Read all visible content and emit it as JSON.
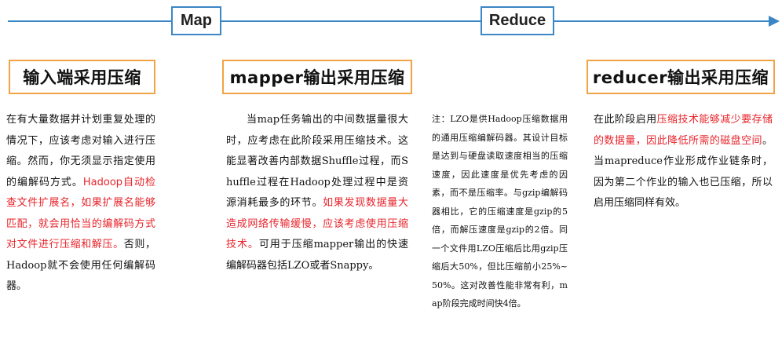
{
  "flow": {
    "map_label": "Map",
    "reduce_label": "Reduce"
  },
  "headings": {
    "input": "输入端采用压缩",
    "mapper": "mapper输出采用压缩",
    "reducer": "reducer输出采用压缩"
  },
  "paragraphs": {
    "input": {
      "part1": "在有大量数据并计划重复处理的情况下，应该考虑对输入进行压缩。然而，你无须显示指定使用的编解码方式。",
      "highlight": "Hadoop自动检查文件扩展名，如果扩展名能够匹配，就会用恰当的编解码方式对文件进行压缩和解压。",
      "part2": "否则，Hadoop就不会使用任何编解码器。"
    },
    "mapper": {
      "part1": "当map任务输出的中间数据量很大时，应考虑在此阶段采用压缩技术。这能显著改善内部数据Shuffle过程，而Shuffle过程在Hadoop处理过程中是资源消耗最多的环节。",
      "highlight": "如果发现数据量大造成网络传输缓慢，应该考虑使用压缩技术。",
      "part2": "可用于压缩mapper输出的快速编解码器包括LZO或者Snappy。"
    },
    "note": {
      "text": "注：LZO是供Hadoop压缩数据用的通用压缩编解码器。其设计目标是达到与硬盘读取速度相当的压缩速度，因此速度是优先考虑的因素，而不是压缩率。与gzip编解码器相比，它的压缩速度是gzip的5倍，而解压速度是gzip的2倍。同一个文件用LZO压缩后比用gzip压缩后大50%，但比压缩前小25%~50%。这对改善性能非常有利，map阶段完成时间快4倍。"
    },
    "reducer": {
      "part1": "在此阶段启用",
      "highlight": "压缩技术能够减少要存储的数据量，因此降低所需的磁盘空间",
      "part2": "。当mapreduce作业形成作业链条时，因为第二个作业的输入也已压缩，所以启用压缩同样有效。"
    }
  }
}
